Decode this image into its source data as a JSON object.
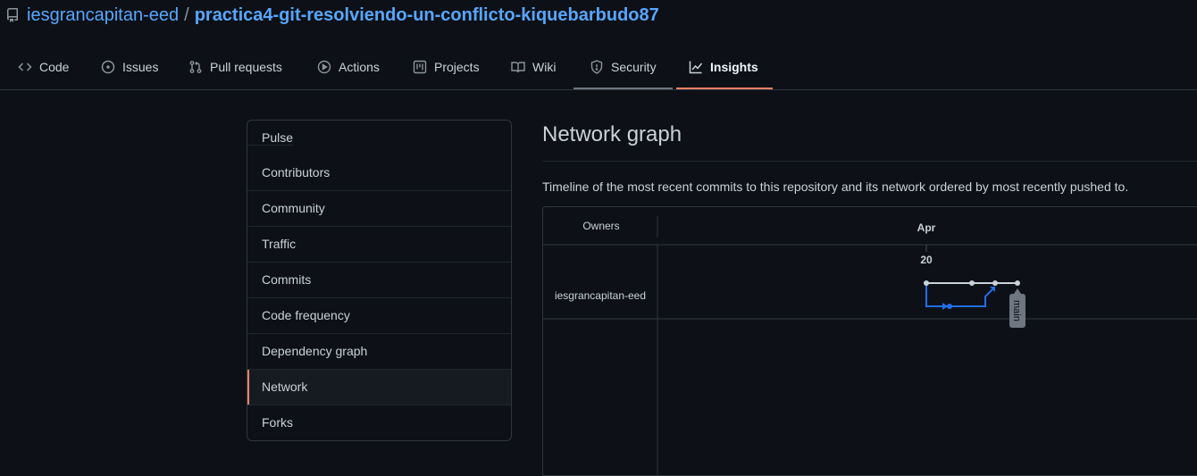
{
  "repo": {
    "owner": "iesgrancapitan-eed",
    "separator": "/",
    "name": "practica4-git-resolviendo-un-conflicto-kiquebarbudo87"
  },
  "tabs": [
    {
      "label": "Code",
      "icon": "code-icon"
    },
    {
      "label": "Issues",
      "icon": "issue-icon"
    },
    {
      "label": "Pull requests",
      "icon": "pull-request-icon"
    },
    {
      "label": "Actions",
      "icon": "play-icon"
    },
    {
      "label": "Projects",
      "icon": "project-icon"
    },
    {
      "label": "Wiki",
      "icon": "book-icon"
    },
    {
      "label": "Security",
      "icon": "shield-icon"
    },
    {
      "label": "Insights",
      "icon": "graph-icon",
      "selected": true
    }
  ],
  "sidebar": {
    "items": [
      {
        "label": "Pulse"
      },
      {
        "label": "Contributors"
      },
      {
        "label": "Community"
      },
      {
        "label": "Traffic"
      },
      {
        "label": "Commits"
      },
      {
        "label": "Code frequency"
      },
      {
        "label": "Dependency graph"
      },
      {
        "label": "Network",
        "selected": true
      },
      {
        "label": "Forks"
      }
    ]
  },
  "main": {
    "title": "Network graph",
    "description": "Timeline of the most recent commits to this repository and its network ordered by most recently pushed to."
  },
  "network": {
    "owners_header": "Owners",
    "month_label": "Apr",
    "day_label": "20",
    "owner_row": "iesgrancapitan-eed",
    "branch_label": "main"
  },
  "colors": {
    "accent": "#f78166",
    "link": "#58a6ff",
    "branch_line": "#1f6feb",
    "main_line": "#c9d1d9"
  }
}
